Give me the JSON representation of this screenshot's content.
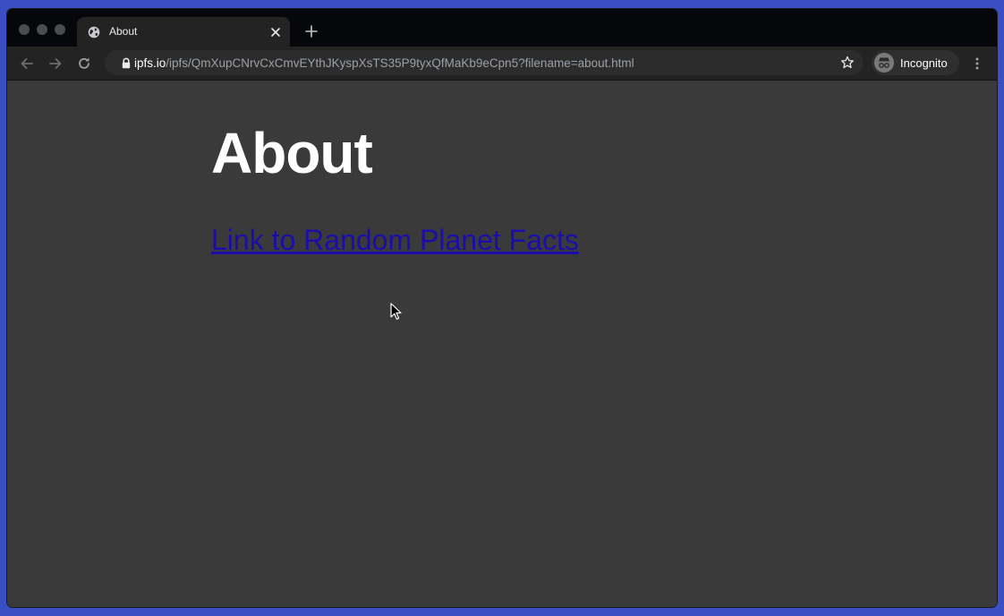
{
  "browser": {
    "tab": {
      "title": "About",
      "favicon": "globe-icon"
    },
    "address_bar": {
      "host": "ipfs.io",
      "path": "/ipfs/QmXupCNrvCxCmvEYthJKyspXsTS35P9tyxQfMaKb9eCpn5?filename=about.html"
    },
    "profile": {
      "label": "Incognito",
      "icon": "incognito-icon"
    },
    "icons": {
      "back": "back-arrow-icon",
      "forward": "forward-arrow-icon",
      "reload": "reload-icon",
      "lock": "lock-icon",
      "bookmark": "star-icon",
      "menu": "kebab-menu-icon",
      "new_tab": "plus-icon",
      "close_tab": "close-icon"
    }
  },
  "page": {
    "title": "About",
    "link_text": "Link to Random Planet Facts"
  },
  "colors": {
    "page_background": "#3a3a3a",
    "link": "#1a0dab",
    "heading": "#ffffff",
    "desktop": "#3a4fc4"
  }
}
